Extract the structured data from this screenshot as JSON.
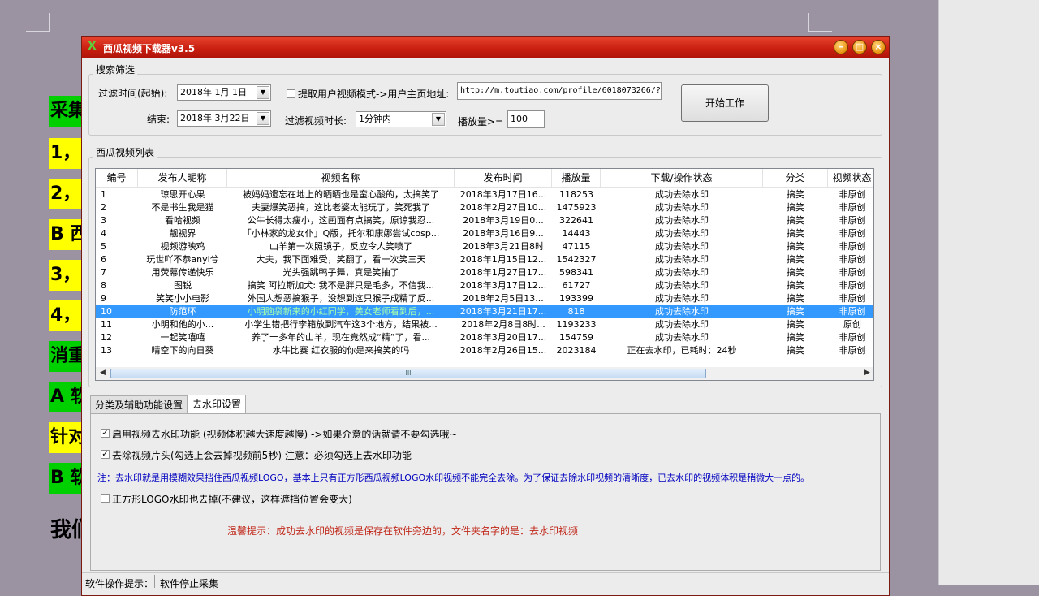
{
  "background_doc": {
    "lines": [
      "采集",
      "1，",
      "2，",
      "B 西",
      "3，",
      "4，",
      "消重",
      "A 软",
      "针对",
      "B 软",
      "我们"
    ]
  },
  "window": {
    "title": "西瓜视频下载器v3.5",
    "title_icon": "X",
    "buttons": {
      "minimize": "–",
      "maximize": "□",
      "close": "×"
    }
  },
  "search_filter": {
    "group_title": "搜索筛选",
    "start_label": "过滤时间(起始):",
    "start_date": "2018年 1月 1日",
    "end_label": "结束:",
    "end_date": "2018年 3月22日",
    "user_mode_label": "提取用户视频模式->用户主页地址:",
    "user_mode_checked": false,
    "user_url": "http://m.toutiao.com/profile/6018073266/?",
    "duration_label": "过滤视频时长:",
    "duration_value": "1分钟内",
    "views_label": "播放量>=",
    "views_value": "100",
    "start_button": "开始工作"
  },
  "video_list": {
    "group_title": "西瓜视频列表",
    "columns": [
      "编号",
      "发布人昵称",
      "视频名称",
      "发布时间",
      "播放量",
      "下载/操作状态",
      "分类",
      "视频状态"
    ],
    "rows": [
      [
        "1",
        "琼思开心果",
        "被妈妈遗忘在地上的晒晒也是蛮心酸的，太搞笑了",
        "2018年3月17日16...",
        "118253",
        "成功去除水印",
        "搞笑",
        "非原创"
      ],
      [
        "2",
        "不是书生我是猫",
        "夫妻爆笑恶搞，这比老婆太能玩了，笑死我了",
        "2018年2月27日10...",
        "1475923",
        "成功去除水印",
        "搞笑",
        "非原创"
      ],
      [
        "3",
        "看哈视频",
        "公牛长得太瘦小，这画面有点搞笑，原谅我忍...",
        "2018年3月19日0...",
        "322641",
        "成功去除水印",
        "搞笑",
        "非原创"
      ],
      [
        "4",
        "靓视界",
        "「小林家的龙女仆」Q版，托尔和康娜尝试cosp...",
        "2018年3月16日9...",
        "14443",
        "成功去除水印",
        "搞笑",
        "非原创"
      ],
      [
        "5",
        "视频游映鸡",
        "山羊第一次照镜子，反应令人笑喷了",
        "2018年3月21日8时",
        "47115",
        "成功去除水印",
        "搞笑",
        "非原创"
      ],
      [
        "6",
        "玩世吖不恭anyi兮",
        "大夫，我下面难受，笑翻了，看一次笑三天",
        "2018年1月15日12...",
        "1542327",
        "成功去除水印",
        "搞笑",
        "非原创"
      ],
      [
        "7",
        "用荧幕传递快乐",
        "光头强跳鸭子舞，真是笑抽了",
        "2018年1月27日17...",
        "598341",
        "成功去除水印",
        "搞笑",
        "非原创"
      ],
      [
        "8",
        "图锐",
        "搞笑 阿拉斯加犬: 我不是胖只是毛多，不信我...",
        "2018年3月17日12...",
        "61727",
        "成功去除水印",
        "搞笑",
        "非原创"
      ],
      [
        "9",
        "笑笑小小电影",
        "外国人想恶搞猴子，没想到这只猴子成精了反...",
        "2018年2月5日13...",
        "193399",
        "成功去除水印",
        "搞笑",
        "非原创"
      ],
      [
        "10",
        "防范环",
        "小明脑袋新来的小红同学，美女老师看到后，...",
        "2018年3月21日17...",
        "818",
        "成功去除水印",
        "搞笑",
        "非原创"
      ],
      [
        "11",
        "小明和他的小...",
        "小学生错把行李箱放到汽车这3个地方，结果被...",
        "2018年2月8日8时...",
        "1193233",
        "成功去除水印",
        "搞笑",
        "原创"
      ],
      [
        "12",
        "一起笑嘻嘻",
        "养了十多年的山羊，现在竟然成“精”了，看...",
        "2018年3月20日17...",
        "154759",
        "成功去除水印",
        "搞笑",
        "非原创"
      ],
      [
        "13",
        "晴空下的向日葵",
        "水牛比赛 红衣服的你是来搞笑的吗",
        "2018年2月26日15...",
        "2023184",
        "正在去水印，已耗时：24秒",
        "搞笑",
        "非原创"
      ]
    ],
    "selected_row": 10,
    "scroll_grip": "III"
  },
  "tabs": [
    "分类及辅助功能设置",
    "去水印设置"
  ],
  "watermark": {
    "enable_label": "启用视频去水印功能  (视频体积越大速度越慢)  ->如果介意的话就请不要勾选哦~",
    "enable_checked": true,
    "remove_head_label": "去除视频片头(勾选上会去掉视频前5秒) 注意：必须勾选上去水印功能",
    "remove_head_checked": true,
    "note": "注：去水印就是用模糊效果挡住西瓜视频LOGO，基本上只有正方形西瓜视频LOGO水印视频不能完全去除。为了保证去除水印视频的清晰度，已去水印的视频体积是稍微大一点的。",
    "square_logo_label": "正方形LOGO水印也去掉(不建议，这样遮挡位置会变大)",
    "square_logo_checked": false,
    "tip": "温馨提示：成功去水印的视频是保存在软件旁边的，文件夹名字的是：去水印视频"
  },
  "status": {
    "label": "软件操作提示：",
    "value": "软件停止采集"
  }
}
